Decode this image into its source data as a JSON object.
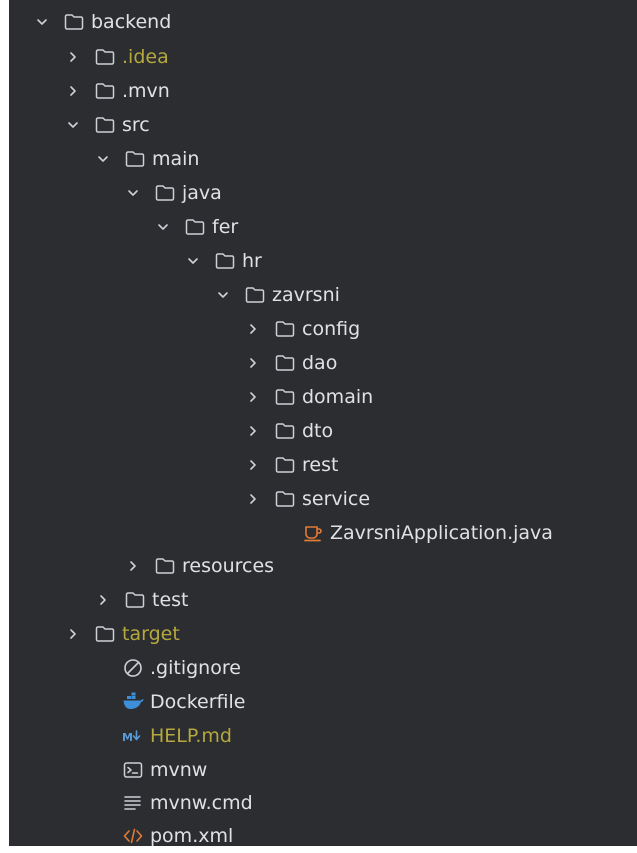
{
  "colors": {
    "background": "#2b2d30",
    "text": "#dfe1e5",
    "ignored_text": "#b5a83e",
    "icon_stroke": "#ced0d6",
    "docker_blue": "#3d8fd9",
    "markdown_blue": "#5a9bd6",
    "java_orange": "#e07b39",
    "xml_orange": "#e07b39"
  },
  "tree": [
    {
      "label": "backend",
      "icon": "folder-icon",
      "state": "expanded",
      "style": "normal"
    },
    {
      "label": ".idea",
      "icon": "folder-icon",
      "state": "collapsed",
      "style": "ignored"
    },
    {
      "label": ".mvn",
      "icon": "folder-icon",
      "state": "collapsed",
      "style": "normal"
    },
    {
      "label": "src",
      "icon": "folder-icon",
      "state": "expanded",
      "style": "normal"
    },
    {
      "label": "main",
      "icon": "folder-icon",
      "state": "expanded",
      "style": "normal"
    },
    {
      "label": "java",
      "icon": "folder-icon",
      "state": "expanded",
      "style": "normal"
    },
    {
      "label": "fer",
      "icon": "folder-icon",
      "state": "expanded",
      "style": "normal"
    },
    {
      "label": "hr",
      "icon": "folder-icon",
      "state": "expanded",
      "style": "normal"
    },
    {
      "label": "zavrsni",
      "icon": "folder-icon",
      "state": "expanded",
      "style": "normal"
    },
    {
      "label": "config",
      "icon": "folder-icon",
      "state": "collapsed",
      "style": "normal"
    },
    {
      "label": "dao",
      "icon": "folder-icon",
      "state": "collapsed",
      "style": "normal"
    },
    {
      "label": "domain",
      "icon": "folder-icon",
      "state": "collapsed",
      "style": "normal"
    },
    {
      "label": "dto",
      "icon": "folder-icon",
      "state": "collapsed",
      "style": "normal"
    },
    {
      "label": "rest",
      "icon": "folder-icon",
      "state": "collapsed",
      "style": "normal"
    },
    {
      "label": "service",
      "icon": "folder-icon",
      "state": "collapsed",
      "style": "normal"
    },
    {
      "label": "ZavrsniApplication.java",
      "icon": "java-class-icon",
      "state": "none",
      "style": "normal"
    },
    {
      "label": "resources",
      "icon": "folder-icon",
      "state": "collapsed",
      "style": "normal"
    },
    {
      "label": "test",
      "icon": "folder-icon",
      "state": "collapsed",
      "style": "normal"
    },
    {
      "label": "target",
      "icon": "folder-icon",
      "state": "collapsed",
      "style": "ignored"
    },
    {
      "label": ".gitignore",
      "icon": "gitignore-icon",
      "state": "none",
      "style": "normal"
    },
    {
      "label": "Dockerfile",
      "icon": "docker-icon",
      "state": "none",
      "style": "normal"
    },
    {
      "label": "HELP.md",
      "icon": "markdown-icon",
      "state": "none",
      "style": "help"
    },
    {
      "label": "mvnw",
      "icon": "terminal-icon",
      "state": "none",
      "style": "normal"
    },
    {
      "label": "mvnw.cmd",
      "icon": "text-file-icon",
      "state": "none",
      "style": "normal"
    },
    {
      "label": "pom.xml",
      "icon": "xml-icon",
      "state": "none",
      "style": "normal"
    }
  ]
}
